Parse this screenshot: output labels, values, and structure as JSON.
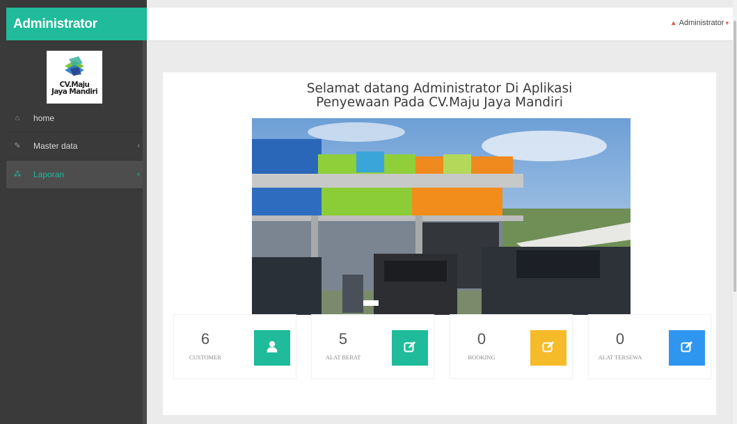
{
  "brand": {
    "title": "Administrator"
  },
  "logo": {
    "line1": "CV.Maju",
    "line2": "Jaya Mandiri"
  },
  "sidebar": {
    "items": [
      {
        "label": "home",
        "icon": "dashboard-icon",
        "glyph": "⌂",
        "caret": ""
      },
      {
        "label": "Master data",
        "icon": "edit-icon",
        "glyph": "✎",
        "caret": "‹"
      },
      {
        "label": "Laporan",
        "icon": "sitemap-icon",
        "glyph": "⁂",
        "caret": "‹"
      }
    ]
  },
  "header": {
    "user_icon_glyph": "▲",
    "user_name": "Administrator",
    "caret": "▾"
  },
  "main": {
    "welcome_line1": "Selamat datang Administrator Di Aplikasi",
    "welcome_line2": "Penyewaan Pada CV.Maju Jaya Mandiri"
  },
  "stats": [
    {
      "value": "6",
      "label": "CUSTOMER",
      "icon": "user-icon",
      "color": "#1fbb9a"
    },
    {
      "value": "5",
      "label": "ALAT BERAT",
      "icon": "edit-icon",
      "color": "#1fbb9a"
    },
    {
      "value": "0",
      "label": "BOOKING",
      "icon": "edit-icon",
      "color": "#f6bb28"
    },
    {
      "value": "0",
      "label": "ALAT TERSEWA",
      "icon": "edit-icon",
      "color": "#2f96f0"
    }
  ],
  "colors": {
    "accent": "#1fbb9a",
    "sidebar": "#3a3a3a",
    "warning": "#f6bb28",
    "info": "#2f96f0"
  }
}
